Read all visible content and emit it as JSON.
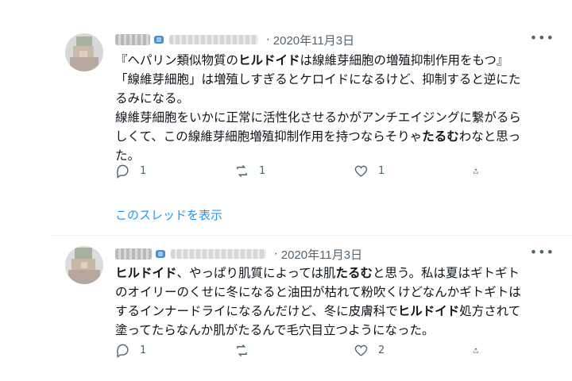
{
  "tweets": [
    {
      "date": "2020年11月3日",
      "lines": [
        [
          {
            "t": "『ヘパリン類似物質の"
          },
          {
            "t": "ヒルドイド",
            "b": true
          },
          {
            "t": "は線維芽細胞の増殖抑制作用をもつ』"
          }
        ],
        [
          {
            "t": "「線維芽細胞」は増殖しすぎるとケロイドになるけど、抑制すると逆にた"
          }
        ],
        [
          {
            "t": "るみになる。"
          }
        ],
        [
          {
            "t": "線維芽細胞をいかに正常に活性化させるかがアンチエイジングに繋がるら"
          }
        ],
        [
          {
            "t": "しくて、この線維芽細胞増殖抑制作用を持つならそりゃ"
          },
          {
            "t": "たるむ",
            "b": true
          },
          {
            "t": "わなと思っ"
          }
        ],
        [
          {
            "t": "た。"
          }
        ]
      ],
      "reply_count": "1",
      "retweet_count": "1",
      "like_count": "1",
      "thread_link": "このスレッドを表示"
    },
    {
      "date": "2020年11月3日",
      "lines": [
        [
          {
            "t": "ヒルドイド",
            "b": true
          },
          {
            "t": "、やっぱり肌質によっては肌"
          },
          {
            "t": "たるむ",
            "b": true
          },
          {
            "t": "と思う。私は夏はギトギト"
          }
        ],
        [
          {
            "t": "のオイリーのくせに冬になると油田が枯れて粉吹くけどなんかギトギトは"
          }
        ],
        [
          {
            "t": "するインナードライになるんだけど、冬に皮膚科で"
          },
          {
            "t": "ヒルドイド",
            "b": true
          },
          {
            "t": "処方されて"
          }
        ],
        [
          {
            "t": "塗ってたらなんか肌がたるんで毛穴目立つようになった。"
          }
        ]
      ],
      "reply_count": "1",
      "retweet_count": "",
      "like_count": "2"
    }
  ],
  "colors": {
    "text": "#0f1419",
    "secondary": "#536471",
    "link": "#1d9bf0",
    "divider": "#eff3f4"
  },
  "icons": [
    "reply-icon",
    "retweet-icon",
    "like-icon",
    "share-icon",
    "more-icon",
    "verified-like-badge-icon"
  ]
}
